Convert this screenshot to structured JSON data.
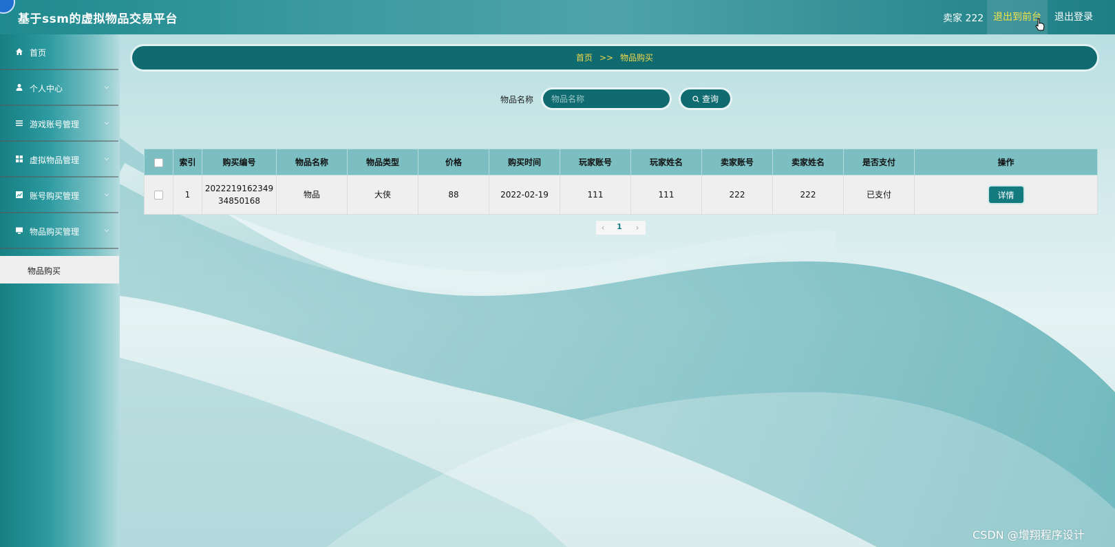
{
  "header": {
    "title": "基于ssm的虚拟物品交易平台",
    "user_label": "卖家 222",
    "nav_front": "退出到前台",
    "nav_logout": "退出登录"
  },
  "sidebar": {
    "items": [
      {
        "label": "首页",
        "icon": "home-icon"
      },
      {
        "label": "个人中心",
        "icon": "user-icon"
      },
      {
        "label": "游戏账号管理",
        "icon": "list-icon"
      },
      {
        "label": "虚拟物品管理",
        "icon": "grid-icon"
      },
      {
        "label": "账号购买管理",
        "icon": "chart-icon"
      },
      {
        "label": "物品购买管理",
        "icon": "monitor-icon"
      }
    ],
    "submenu": {
      "label": "物品购买"
    }
  },
  "breadcrumb": {
    "home": "首页",
    "sep": ">>",
    "current": "物品购买"
  },
  "search": {
    "label": "物品名称",
    "placeholder": "物品名称",
    "value": "",
    "button_label": "查询"
  },
  "table": {
    "headers": [
      "索引",
      "购买编号",
      "物品名称",
      "物品类型",
      "价格",
      "购买时间",
      "玩家账号",
      "玩家姓名",
      "卖家账号",
      "卖家姓名",
      "是否支付",
      "操作"
    ],
    "rows": [
      {
        "index": "1",
        "order_no_line1": "2022219162349",
        "order_no_line2": "34850168",
        "item_name": "物品",
        "item_type": "大侠",
        "price": "88",
        "purchase_time": "2022-02-19",
        "player_account": "111",
        "player_name": "111",
        "seller_account": "222",
        "seller_name": "222",
        "paid": "已支付",
        "action_label": "详情"
      }
    ]
  },
  "pager": {
    "prev": "‹",
    "current": "1",
    "next": "›"
  },
  "watermark": "CSDN @增翔程序设计",
  "colors": {
    "accent": "#0f6b70",
    "header_bg": "#3b9aa0",
    "highlight_text": "#f4e44a"
  }
}
